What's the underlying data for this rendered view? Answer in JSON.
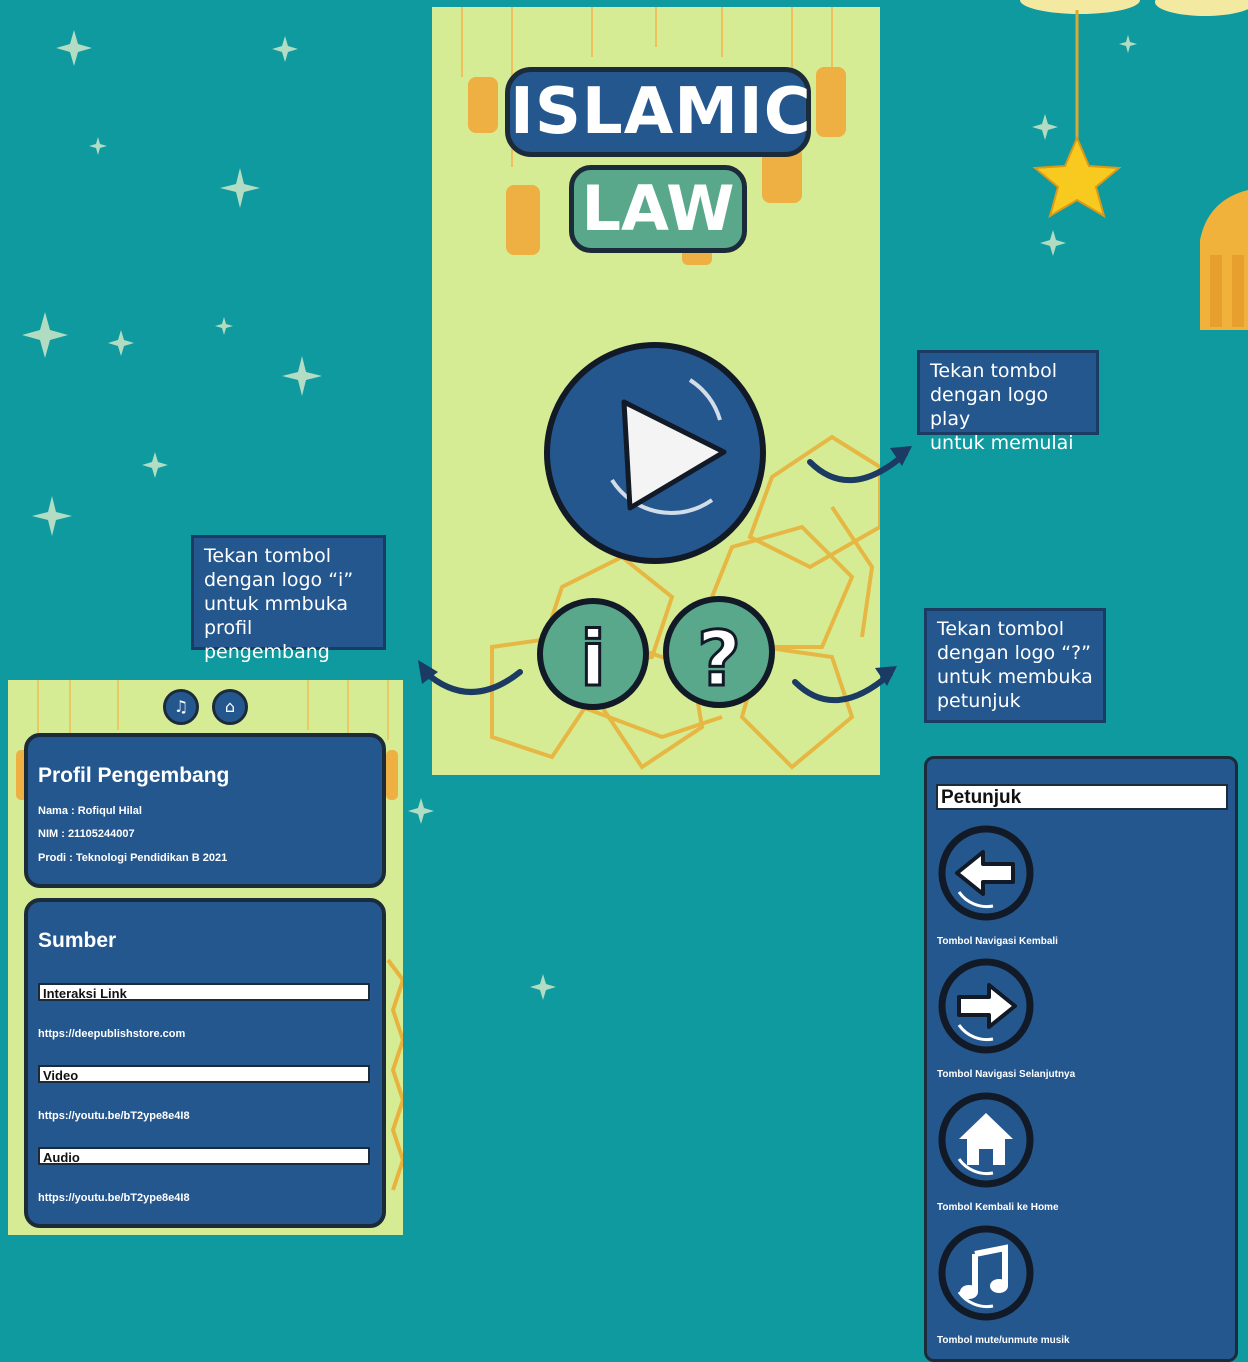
{
  "home": {
    "logo_line1": "ISLAMIC",
    "logo_line2": "LAW",
    "info_glyph": "i",
    "help_glyph": "?"
  },
  "callouts": {
    "play": [
      "Tekan tombol",
      "dengan logo play",
      "untuk memulai"
    ],
    "info": [
      "Tekan tombol",
      "dengan logo “i”",
      "untuk mmbuka",
      "profil pengembang"
    ],
    "help": [
      "Tekan tombol",
      "dengan logo “?”",
      "untuk membuka",
      "petunjuk"
    ]
  },
  "profile": {
    "music_icon": "music-note-icon",
    "home_icon": "home-icon",
    "title": "Profil Pengembang",
    "nama": "Nama : Rofiqul Hilal",
    "nim": "NIM : 21105244007",
    "prodi": "Prodi : Teknologi Pendidikan B 2021"
  },
  "sources": {
    "title": "Sumber",
    "items": [
      {
        "label": "Interaksi Link",
        "url": "https://deepublishstore.com"
      },
      {
        "label": "Video",
        "url": "https://youtu.be/bT2ype8e4I8"
      },
      {
        "label": "Audio",
        "url": "https://youtu.be/bT2ype8e4I8"
      }
    ]
  },
  "help": {
    "title": "Petunjuk",
    "items": [
      {
        "icon": "arrow-left-icon",
        "caption": "Tombol Navigasi Kembali"
      },
      {
        "icon": "arrow-right-icon",
        "caption": "Tombol Navigasi Selanjutnya"
      },
      {
        "icon": "home-icon",
        "caption": "Tombol Kembali ke Home"
      },
      {
        "icon": "music-note-icon",
        "caption": "Tombol mute/unmute musik"
      }
    ]
  },
  "colors": {
    "background": "#0e9a9e",
    "panel": "#d6ec94",
    "button_blue": "#25578f",
    "button_green": "#5aa88b",
    "outline": "#1c2b3a",
    "lantern": "#f0b03a"
  }
}
